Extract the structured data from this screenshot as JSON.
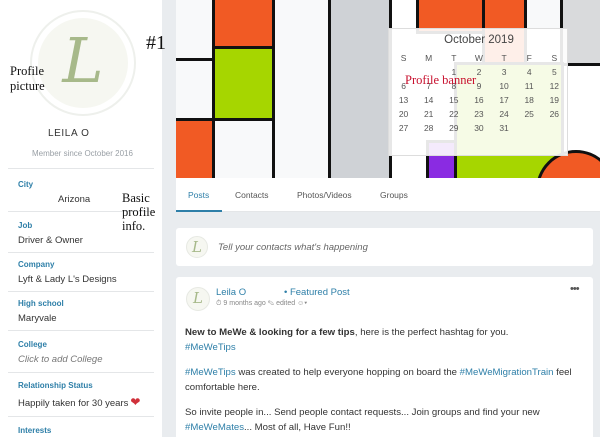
{
  "annotations": {
    "number": "#1",
    "profile_picture": "Profile picture",
    "profile_banner": "Profile banner",
    "basic_info": "Basic profile info."
  },
  "profile": {
    "avatar_letter": "L",
    "name": "LEILA O",
    "member_since": "Member since October 2016"
  },
  "info": [
    {
      "label": "City",
      "value": "Arizona"
    },
    {
      "label": "Job",
      "value": "Driver & Owner"
    },
    {
      "label": "Company",
      "value": "Lyft & Lady L's Designs"
    },
    {
      "label": "High school",
      "value": "Maryvale"
    },
    {
      "label": "College",
      "value": "Click to add College"
    },
    {
      "label": "Relationship Status",
      "value": "Happily taken for 30 years"
    },
    {
      "label": "Interests",
      "value": ""
    }
  ],
  "calendar": {
    "title": "October 2019",
    "weekdays": [
      "S",
      "M",
      "T",
      "W",
      "T",
      "F",
      "S"
    ],
    "days": [
      "",
      "",
      "1",
      "2",
      "3",
      "4",
      "5",
      "6",
      "7",
      "8",
      "9",
      "10",
      "11",
      "12",
      "13",
      "14",
      "15",
      "16",
      "17",
      "18",
      "19",
      "20",
      "21",
      "22",
      "23",
      "24",
      "25",
      "26",
      "27",
      "28",
      "29",
      "30",
      "31",
      "",
      ""
    ]
  },
  "tabs": [
    "Posts",
    "Contacts",
    "Photos/Videos",
    "Groups"
  ],
  "composer": {
    "placeholder": "Tell your contacts what's happening"
  },
  "post": {
    "author": "Leila O",
    "featured": "• Featured Post",
    "meta": "⏱ 9 months ago  ✎ edited  ☺▾",
    "more": "•••",
    "p1_bold": "New to MeWe & looking for a few tips",
    "p1_rest": ", here is the perfect hashtag for you.",
    "p1_tag": "#MeWeTips",
    "p2_tag1": "#MeWeTips",
    "p2_mid": " was created to help everyone hopping on board the ",
    "p2_tag2": "#MeWeMigrationTrain",
    "p2_rest": " feel comfortable here.",
    "p3_start": "So invite people in... Send people contact requests... Join groups and find your new ",
    "p3_tag": "#MeWeMates",
    "p3_end": "... Most of all, Have Fun!!"
  },
  "colors": {
    "accent": "#2e7fa8",
    "annotation_red": "#c8102e"
  }
}
